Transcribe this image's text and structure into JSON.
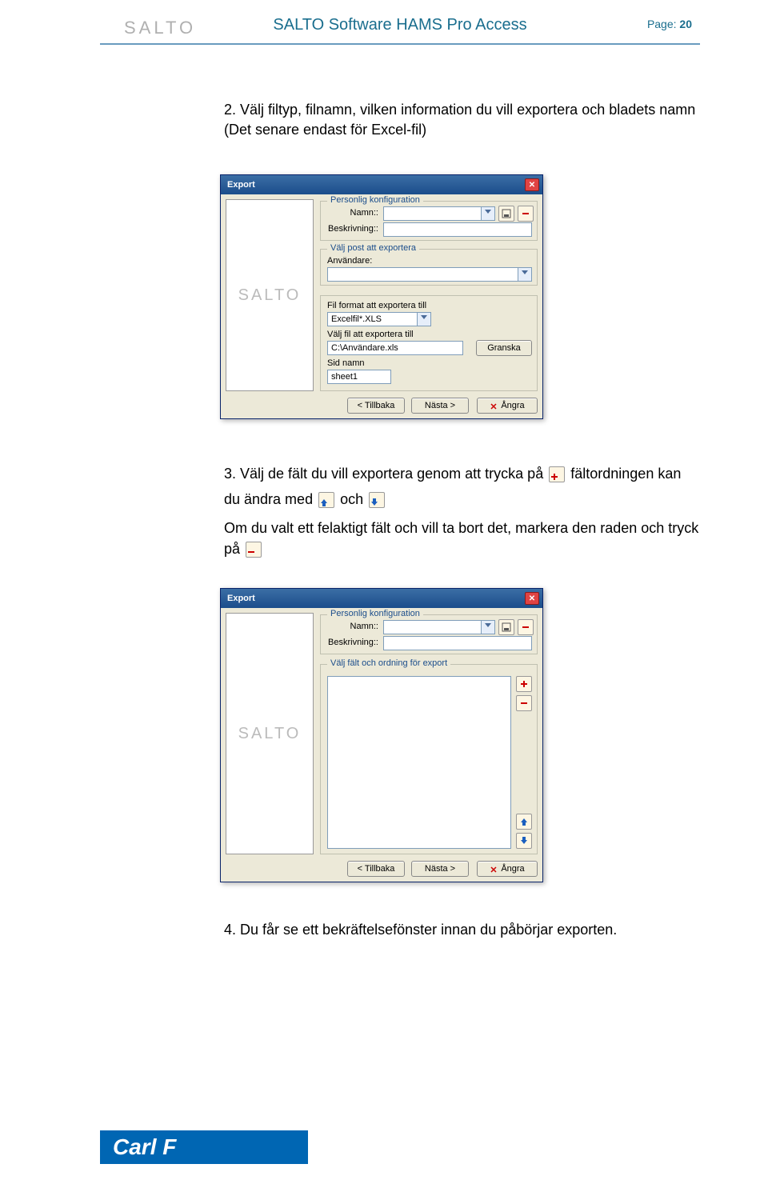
{
  "header": {
    "logo": "SALTO",
    "title": "SALTO Software HAMS Pro Access",
    "page_label": "Page:",
    "page_number": "20"
  },
  "body": {
    "step2": "2. Välj filtyp, filnamn, vilken information du vill exportera och bladets namn (Det senare endast för Excel-fil)",
    "step3_part1": "3. Välj de fält du vill exportera genom att trycka på",
    "step3_part2": "fältordningen kan",
    "step3_line2a": "du ändra med",
    "step3_line2b": "och",
    "step3_line3": "Om du valt ett felaktigt fält och vill ta bort det, markera den raden och tryck",
    "step3_line4": "på",
    "step4": "4. Du får se ett bekräftelsefönster innan du påbörjar exporten."
  },
  "win1": {
    "title": "Export",
    "salto": "SALTO",
    "config_legend": "Personlig konfiguration",
    "namn_label": "Namn::",
    "beskr_label": "Beskrivning::",
    "post_legend": "Välj post att exportera",
    "anvandare_label": "Användare:",
    "format_label": "Fil format att exportera till",
    "format_value": "Excelfil*.XLS",
    "valfil_label": "Välj fil att exportera till",
    "filepath": "C:\\Användare.xls",
    "granska": "Granska",
    "sidnamn_label": "Sid namn",
    "sidnamn_value": "sheet1",
    "back": "< Tillbaka",
    "next": "Nästa >",
    "cancel": "Ångra"
  },
  "win2": {
    "title": "Export",
    "salto": "SALTO",
    "config_legend": "Personlig konfiguration",
    "namn_label": "Namn::",
    "beskr_label": "Beskrivning::",
    "fields_legend": "Välj fält och ordning för export",
    "back": "< Tillbaka",
    "next": "Nästa >",
    "cancel": "Ångra"
  },
  "footer": {
    "brand": "Carl F"
  }
}
